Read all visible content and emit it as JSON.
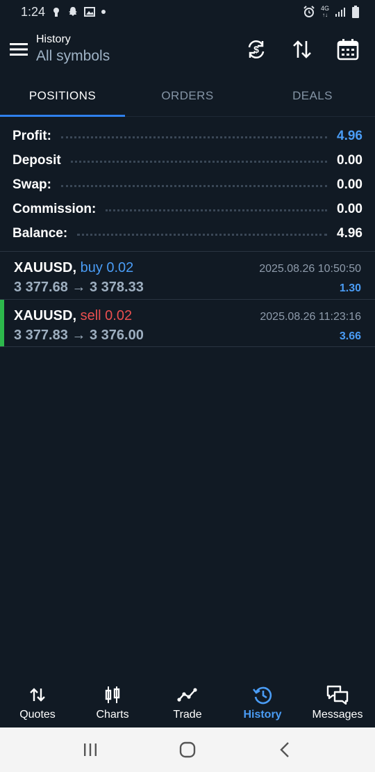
{
  "status_bar": {
    "time": "1:24",
    "network_label": "4G"
  },
  "header": {
    "subtitle": "History",
    "title": "All symbols"
  },
  "tabs": [
    {
      "label": "POSITIONS",
      "active": true
    },
    {
      "label": "ORDERS",
      "active": false
    },
    {
      "label": "DEALS",
      "active": false
    }
  ],
  "summary": {
    "profit": {
      "label": "Profit:",
      "value": "4.96"
    },
    "deposit": {
      "label": "Deposit",
      "value": "0.00"
    },
    "swap": {
      "label": "Swap:",
      "value": "0.00"
    },
    "commission": {
      "label": "Commission:",
      "value": "0.00"
    },
    "balance": {
      "label": "Balance:",
      "value": "4.96"
    }
  },
  "positions": [
    {
      "symbol": "XAUUSD,",
      "side_volume": "buy 0.02",
      "side": "buy",
      "datetime": "2025.08.26 10:50:50",
      "prices": "3 377.68 → 3 378.33",
      "profit": "1.30"
    },
    {
      "symbol": "XAUUSD,",
      "side_volume": "sell 0.02",
      "side": "sell",
      "datetime": "2025.08.26 11:23:16",
      "prices": "3 377.83 → 3 376.00",
      "profit": "3.66"
    }
  ],
  "bottom_nav": [
    {
      "label": "Quotes",
      "icon": "quotes-arrows-icon",
      "active": false
    },
    {
      "label": "Charts",
      "icon": "candlestick-icon",
      "active": false
    },
    {
      "label": "Trade",
      "icon": "trade-line-icon",
      "active": false
    },
    {
      "label": "History",
      "icon": "history-clock-icon",
      "active": true
    },
    {
      "label": "Messages",
      "icon": "chat-bubbles-icon",
      "active": false
    }
  ],
  "colors": {
    "background": "#111a24",
    "accent_blue": "#4a9cf5",
    "sell_red": "#ea4f4f",
    "selected_green": "#2db84c"
  }
}
